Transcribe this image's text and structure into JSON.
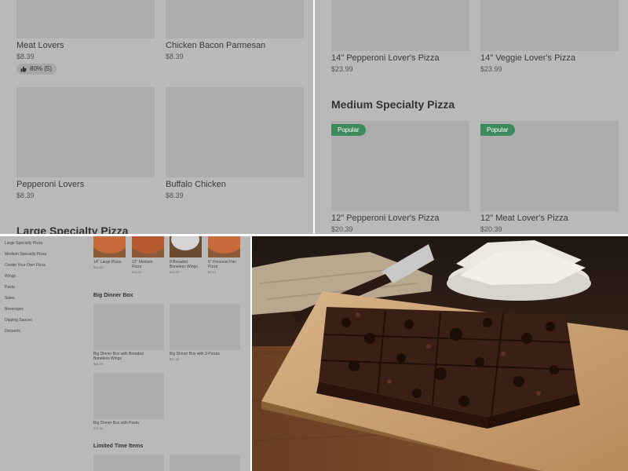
{
  "tl": {
    "items": [
      {
        "name": "Meat Lovers",
        "price": "$8.39"
      },
      {
        "name": "Chicken Bacon Parmesan",
        "price": "$8.39"
      },
      {
        "name": "Pepperoni Lovers",
        "price": "$8.39"
      },
      {
        "name": "Buffalo Chicken",
        "price": "$8.39"
      }
    ],
    "rating": "80% (5)",
    "section_heading": "Large Specialty Pizza"
  },
  "tr": {
    "items": [
      {
        "name": "14\" Pepperoni Lover's Pizza",
        "price": "$23.99"
      },
      {
        "name": "14\" Veggie Lover's Pizza",
        "price": "$23.99"
      },
      {
        "name": "12\" Pepperoni Lover's Pizza",
        "price": "$20.39"
      },
      {
        "name": "12\" Meat Lover's Pizza",
        "price": "$20.39"
      }
    ],
    "section_heading": "Medium Specialty Pizza",
    "badge": "Popular",
    "badge_color": "#3d8a5c"
  },
  "bl": {
    "sidebar": [
      "Large Specialty Pizza",
      "Medium Specialty Pizza",
      "Create Your Own Pizza",
      "Wings",
      "Pasta",
      "Sides",
      "Beverages",
      "Dipping Sauces",
      "Desserts"
    ],
    "thumbs": [
      {
        "name": "14\" Large Pizza",
        "price": "$23.59"
      },
      {
        "name": "12\" Medium Pizza",
        "price": "$13.19"
      },
      {
        "name": "8 Breaded Boneless Wings",
        "price": "$10.79"
      },
      {
        "name": "6\" Personal Pan Pizza",
        "price": "$7.19"
      }
    ],
    "big_dinner_heading": "Big Dinner Box",
    "big_dinner": [
      {
        "name": "Big Dinner Box with Breaded Boneless Wings",
        "price": "$31.34"
      },
      {
        "name": "Big Dinner Box with 3 Pizzas",
        "price": "$31.26"
      },
      {
        "name": "Big Dinner Box with Pasta",
        "price": "$31.34"
      }
    ],
    "limited_heading": "Limited Time Items"
  },
  "icons": {
    "rating": "thumbs-up-icon"
  }
}
